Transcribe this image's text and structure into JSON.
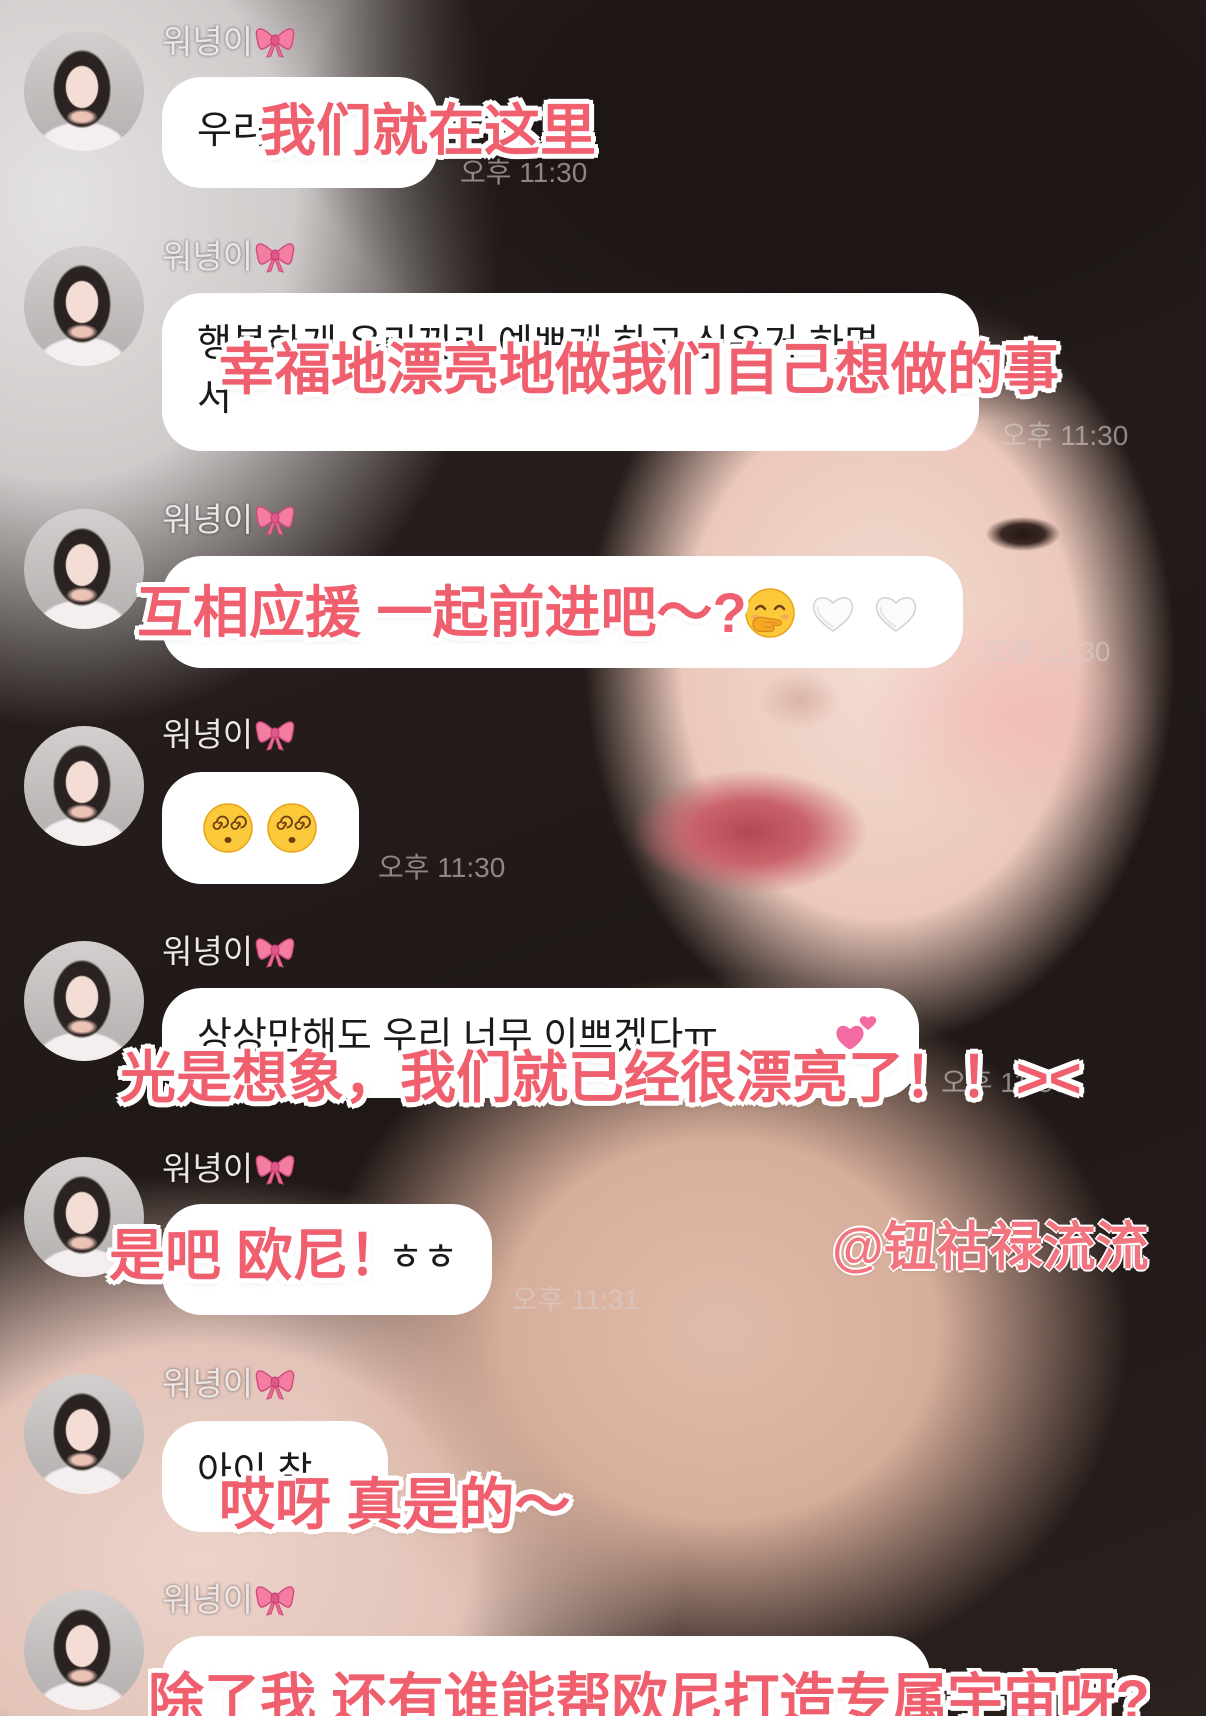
{
  "sender": {
    "name": "워녕이",
    "name_badge_icon": "ribbon-bow-icon",
    "avatar_icon": "profile-photo-avatar"
  },
  "messages": [
    {
      "lines": [
        "우리"
      ],
      "time": "오후 11:30",
      "caption": "我们就在这里"
    },
    {
      "lines": [
        "행복하게 우리끼리 예쁘게 하고 싶은거 하면",
        "서"
      ],
      "time": "오후 11:30",
      "caption": "幸福地漂亮地做我们自己想做的事"
    },
    {
      "emoji_icons": [
        "face-with-hand-over-mouth-icon",
        "white-heart-icon",
        "white-heart-icon"
      ],
      "time": "오후 11:30",
      "caption": "互相应援 一起前进吧～?"
    },
    {
      "emoji_icons": [
        "face-with-spiral-eyes-icon",
        "face-with-spiral-eyes-icon"
      ],
      "time": "오후 11:30"
    },
    {
      "lines": [
        "상상만해도 우리 너무 이쁘겠다ㅠ"
      ],
      "emoji_icons": [
        "two-hearts-icon"
      ],
      "time": "오후 11:30",
      "caption": "光是想象，我们就已经很漂亮了！！><"
    },
    {
      "lines": [
        "ㅎㅎ"
      ],
      "time": "오후 11:31",
      "caption": "是吧 欧尼！"
    },
    {
      "lines": [
        "아이 참"
      ],
      "caption": "哎呀 真是的～"
    },
    {
      "caption": "除了我 还有谁能帮欧尼打造专属宇宙呀?"
    }
  ],
  "watermark": "@钮祜禄流流",
  "colors": {
    "caption": "#ef5f6e",
    "caption_outline": "#ffffff",
    "bubble": "#ffffff",
    "watermark": "#f2747f"
  }
}
